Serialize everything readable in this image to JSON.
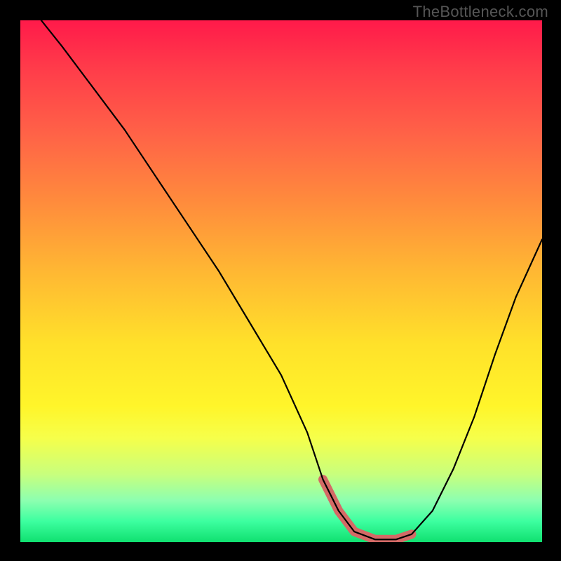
{
  "attribution": "TheBottleneck.com",
  "chart_data": {
    "type": "line",
    "title": "",
    "xlabel": "",
    "ylabel": "",
    "xlim": [
      0,
      100
    ],
    "ylim": [
      0,
      100
    ],
    "background_gradient": {
      "top": "#ff1a4a",
      "bottom": "#10e070"
    },
    "series": [
      {
        "name": "curve",
        "color": "#000000",
        "x": [
          4,
          8,
          14,
          20,
          26,
          32,
          38,
          44,
          50,
          55,
          58,
          61,
          64,
          68,
          72,
          75,
          79,
          83,
          87,
          91,
          95,
          100
        ],
        "y": [
          100,
          95,
          87,
          79,
          70,
          61,
          52,
          42,
          32,
          21,
          12,
          6,
          2,
          0.5,
          0.5,
          1.5,
          6,
          14,
          24,
          36,
          47,
          58
        ]
      }
    ],
    "accent_segment": {
      "color": "#d46a66",
      "x_range": [
        58,
        75
      ],
      "notes": "flat segment near the minimum, highlighted"
    }
  }
}
